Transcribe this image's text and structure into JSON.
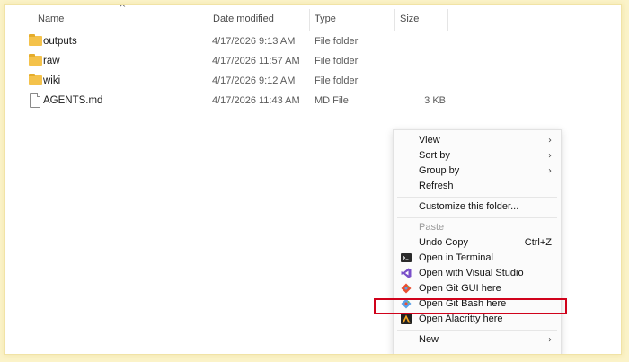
{
  "columns": {
    "name": "Name",
    "date_modified": "Date modified",
    "type": "Type",
    "size": "Size"
  },
  "sort_indicator": "^",
  "files": [
    {
      "name": "outputs",
      "date": "4/17/2026 9:13 AM",
      "type": "File folder",
      "size": "",
      "icon": "folder-icon"
    },
    {
      "name": "raw",
      "date": "4/17/2026 11:57 AM",
      "type": "File folder",
      "size": "",
      "icon": "folder-icon"
    },
    {
      "name": "wiki",
      "date": "4/17/2026 9:12 AM",
      "type": "File folder",
      "size": "",
      "icon": "folder-icon"
    },
    {
      "name": "AGENTS.md",
      "date": "4/17/2026 11:43 AM",
      "type": "MD File",
      "size": "3 KB",
      "icon": "file-icon"
    }
  ],
  "context_menu": {
    "view": "View",
    "sort_by": "Sort by",
    "group_by": "Group by",
    "refresh": "Refresh",
    "customize": "Customize this folder...",
    "paste": "Paste",
    "undo_copy": "Undo Copy",
    "undo_shortcut": "Ctrl+Z",
    "open_terminal": "Open in Terminal",
    "open_visual_studio": "Open with Visual Studio",
    "open_git_gui": "Open Git GUI here",
    "open_git_bash": "Open Git Bash here",
    "open_alacritty": "Open Alacritty here",
    "new": "New",
    "submenu_arrow": "›"
  },
  "colors": {
    "highlight_border": "#d0021b",
    "folder": "#f4c24b",
    "background_glow": "#fbf3c9"
  }
}
